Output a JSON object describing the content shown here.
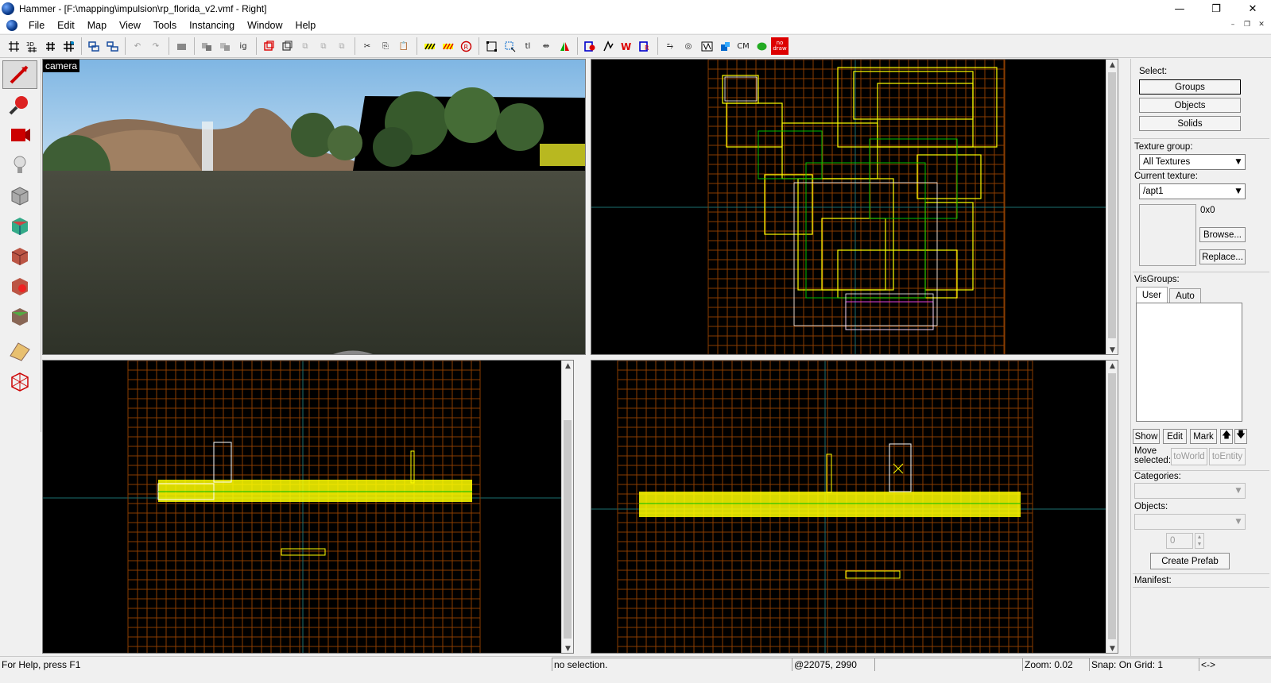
{
  "window": {
    "title": "Hammer - [F:\\mapping\\impulsion\\rp_florida_v2.vmf - Right]",
    "minimize": "—",
    "maximize": "❐",
    "close": "✕"
  },
  "menu": {
    "items": [
      "File",
      "Edit",
      "Map",
      "View",
      "Tools",
      "Instancing",
      "Window",
      "Help"
    ],
    "mdi_min": "–",
    "mdi_restore": "❐",
    "mdi_close": "✕"
  },
  "toolbar": {
    "buttons": [
      "grid-icon",
      "3d-grid-icon",
      "grid-small-icon",
      "grid-large-icon",
      "group-icon",
      "ungroup-icon",
      "undo-icon",
      "redo-icon",
      "carve-icon",
      "hollow-icon",
      "align-icon",
      "texture-lock-icon",
      "ig-icon",
      "cut-icon",
      "copy-icon",
      "paste-icon",
      "hazard-icon",
      "hazard2-icon",
      "run-map-icon",
      "select-all-icon",
      "transform-icon",
      "tl-icon",
      "flip-icon",
      "mirror-icon",
      "cordon-icon",
      "cm-icon",
      "leaf-icon",
      "nodraw-icon"
    ],
    "ig_label": "ig",
    "tl_label": "tl",
    "cm_label": "CM",
    "nodraw_label": "no draw"
  },
  "left_tools": [
    "selection-tool",
    "magnify-tool",
    "camera-tool",
    "entity-tool",
    "block-tool",
    "texture-application-tool",
    "apply-current-texture-tool",
    "decal-tool",
    "overlay-tool",
    "clipping-tool",
    "vertex-tool"
  ],
  "viewports": {
    "camera_label": "camera"
  },
  "right_panel": {
    "select_label": "Select:",
    "groups_btn": "Groups",
    "objects_btn": "Objects",
    "solids_btn": "Solids",
    "texture_group_label": "Texture group:",
    "texture_group_value": "All Textures",
    "current_texture_label": "Current texture:",
    "current_texture_value": "/apt1",
    "texture_size": "0x0",
    "browse_btn": "Browse...",
    "replace_btn": "Replace...",
    "visgroups_label": "VisGroups:",
    "tab_user": "User",
    "tab_auto": "Auto",
    "show_btn": "Show",
    "edit_btn": "Edit",
    "mark_btn": "Mark",
    "up_btn": "🡅",
    "down_btn": "🡇",
    "move_selected_label": "Move selected:",
    "toworld_btn": "toWorld",
    "toentity_btn": "toEntity",
    "categories_label": "Categories:",
    "objects_label": "Objects:",
    "spin_value": "0",
    "create_prefab_btn": "Create Prefab",
    "manifest_label": "Manifest:"
  },
  "statusbar": {
    "help": "For Help, press F1",
    "selection": "no selection.",
    "coords": "@22075, 2990",
    "zoom": "Zoom: 0.02",
    "snap": "Snap: On Grid: 1",
    "arrows": "<->"
  },
  "colors": {
    "grid_orange": "#8a3d00",
    "axis_teal": "#1d6f6f",
    "brush_yellow": "#ffff00",
    "brush_green": "#00c000",
    "brush_white": "#ffffff",
    "sky": "#9cc8e8"
  }
}
